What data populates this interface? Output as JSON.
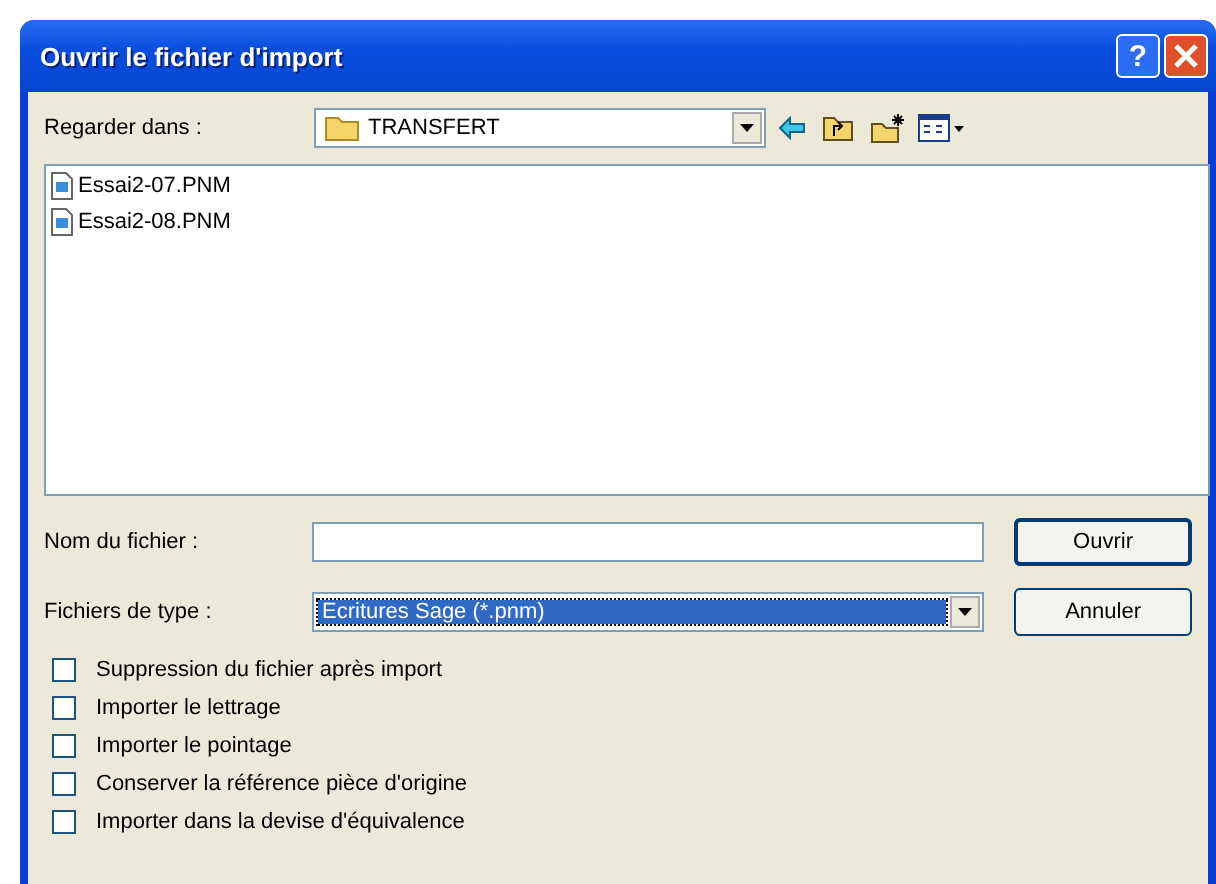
{
  "window": {
    "title": "Ouvrir le fichier d'import",
    "help_button": "?"
  },
  "look_in": {
    "label": "Regarder dans :",
    "value": "TRANSFERT"
  },
  "files": [
    {
      "name": "Essai2-07.PNM",
      "selected": false
    },
    {
      "name": "Essai2-08.PNM",
      "selected": false
    }
  ],
  "file_name": {
    "label": "Nom du fichier :"
  },
  "file_type": {
    "label": "Fichiers de type :",
    "value": "Ecritures Sage (*.pnm)"
  },
  "buttons": [
    "Ouvrir",
    "Annuler"
  ],
  "options": [
    {
      "label": "Suppression du fichier après import",
      "checked": false
    },
    {
      "label": "Importer le lettrage",
      "checked": false
    },
    {
      "label": "Importer le pointage",
      "checked": false
    },
    {
      "label": "Conserver la référence pièce d'origine",
      "checked": false
    },
    {
      "label": "Importer dans la devise d'équivalence",
      "checked": false
    }
  ]
}
